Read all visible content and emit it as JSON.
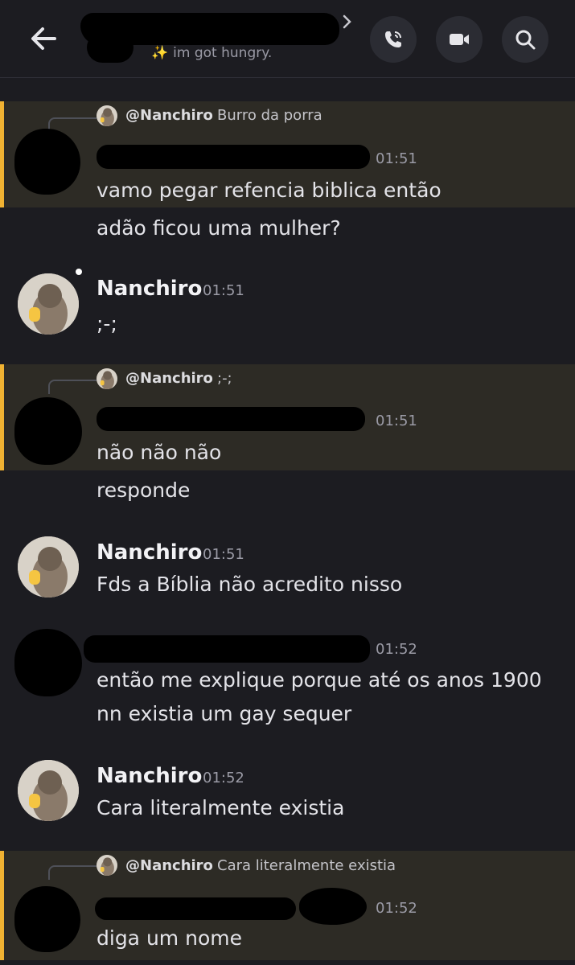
{
  "header": {
    "back_icon": "arrow-left-icon",
    "status_emoji": "✨",
    "status_text": "im got hungry.",
    "buttons": [
      "phone-call-icon",
      "video-camera-icon",
      "search-icon"
    ]
  },
  "reply_mention": "@Nanchiro",
  "messages": [
    {
      "reply_snippet": "Burro da porra",
      "time": "01:51",
      "lines": [
        "vamo pegar refencia biblica então",
        "adão ficou uma mulher?"
      ]
    },
    {
      "author": "Nanchiro",
      "time": "01:51",
      "lines": [
        ";-;"
      ]
    },
    {
      "reply_snippet": ";-;",
      "time": "01:51",
      "lines": [
        "não não não",
        "responde"
      ]
    },
    {
      "author": "Nanchiro",
      "time": "01:51",
      "lines": [
        "Fds a Bíblia não acredito nisso"
      ]
    },
    {
      "time": "01:52",
      "lines": [
        "então me explique porque até os anos 1900",
        "nn existia um gay sequer"
      ]
    },
    {
      "author": "Nanchiro",
      "time": "01:52",
      "lines": [
        "Cara literalmente existia"
      ]
    },
    {
      "reply_snippet": "Cara literalmente existia",
      "time": "01:52",
      "lines": [
        "diga um nome"
      ]
    }
  ],
  "colors": {
    "background": "#1c1c21",
    "reply_highlight": "#2d2b25",
    "reply_accent": "#f0b232",
    "timestamp": "#9b9ba6"
  }
}
